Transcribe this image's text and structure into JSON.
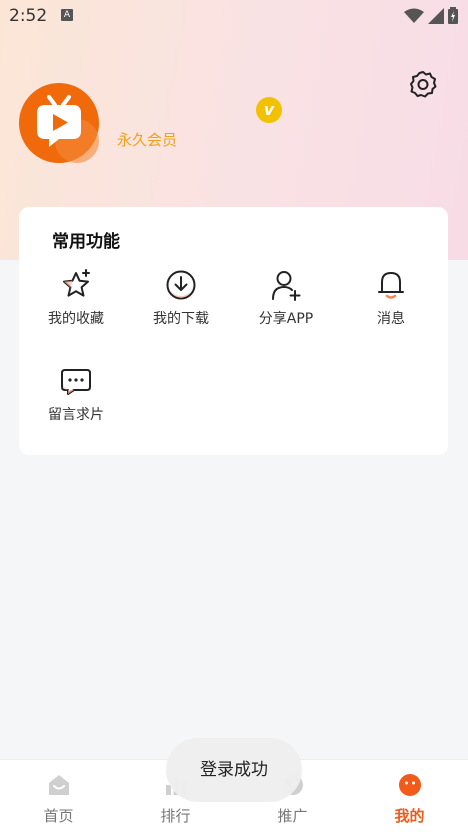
{
  "status_bar": {
    "time": "2:52",
    "notification_letter": "A"
  },
  "profile": {
    "membership_label": "永久会员",
    "vip_letter": "v"
  },
  "functions": {
    "title": "常用功能",
    "items": [
      {
        "label": "我的收藏",
        "icon": "star-icon"
      },
      {
        "label": "我的下载",
        "icon": "download-icon"
      },
      {
        "label": "分享APP",
        "icon": "add-user-icon"
      },
      {
        "label": "消息",
        "icon": "bell-icon"
      },
      {
        "label": "留言求片",
        "icon": "message-icon"
      }
    ]
  },
  "bottom_nav": {
    "items": [
      {
        "label": "首页",
        "icon": "home-icon"
      },
      {
        "label": "排行",
        "icon": "chart-icon"
      },
      {
        "label": "推广",
        "icon": "promote-icon"
      },
      {
        "label": "我的",
        "icon": "profile-icon",
        "active": true
      }
    ]
  },
  "toast": {
    "message": "登录成功"
  },
  "colors": {
    "accent": "#f05a1a",
    "member": "#f2a11a",
    "vip": "#f2c200",
    "logo": "#f06a0c"
  }
}
